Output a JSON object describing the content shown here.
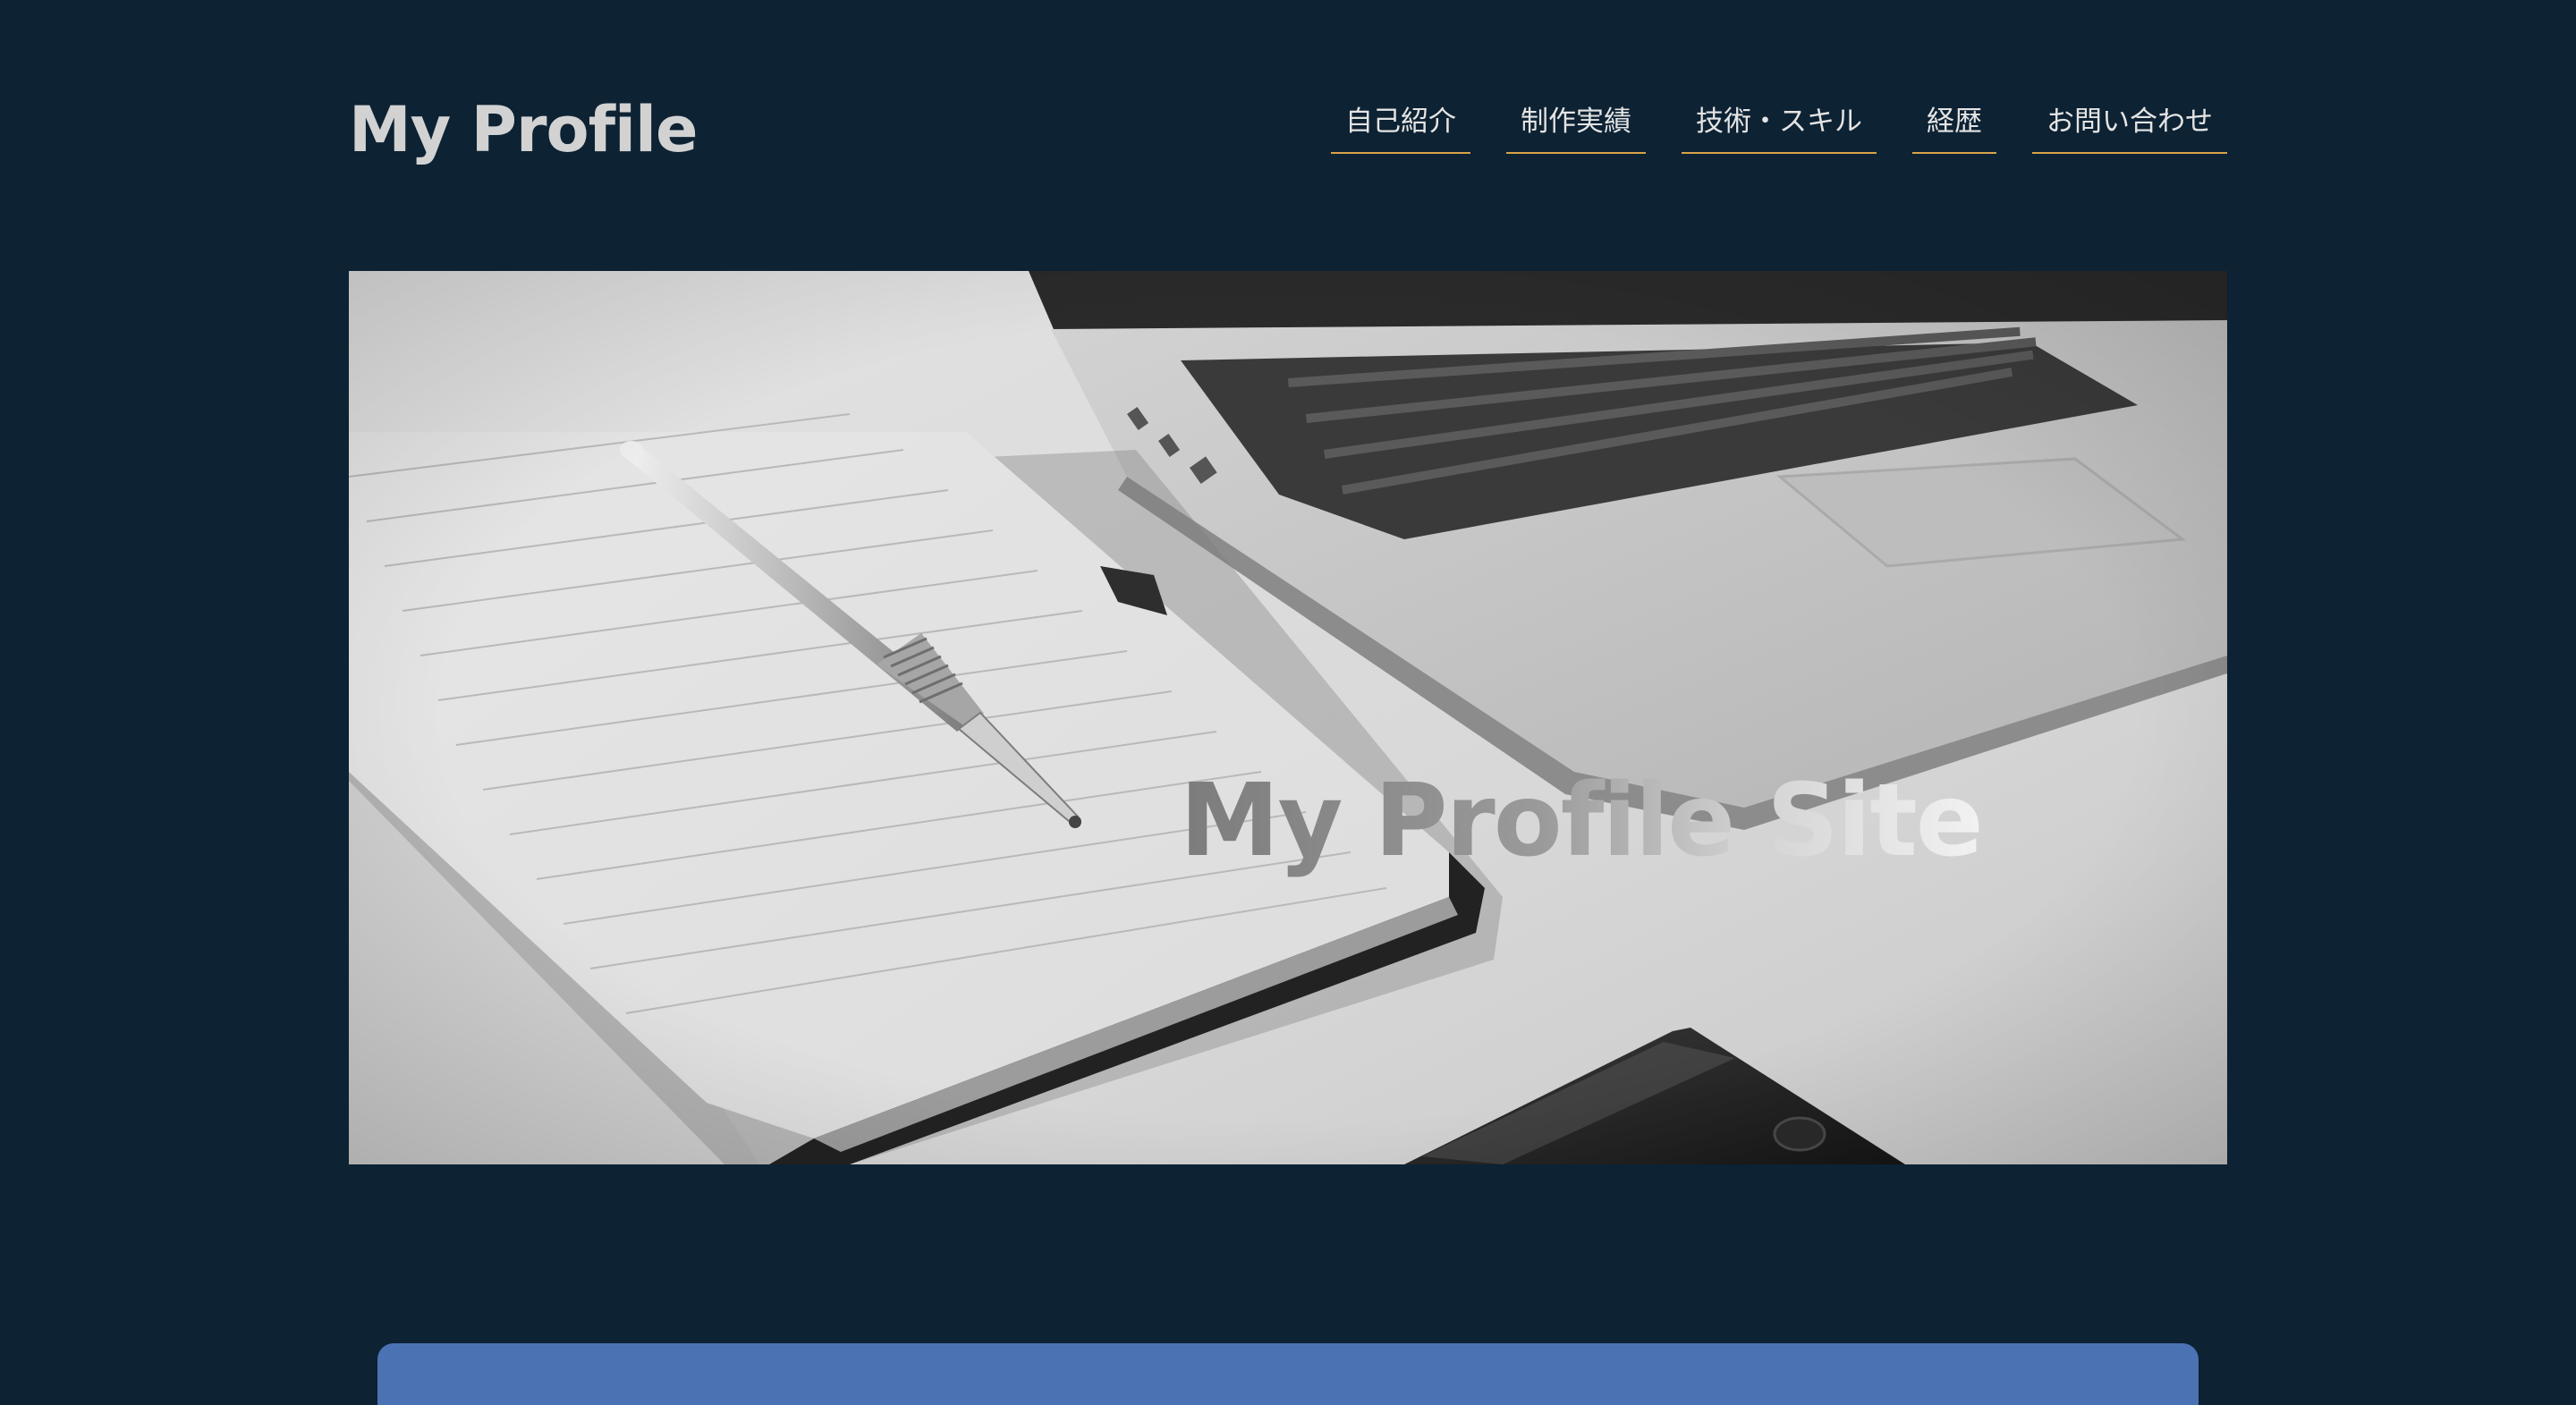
{
  "header": {
    "title": "My Profile",
    "nav": [
      {
        "label": "自己紹介"
      },
      {
        "label": "制作実績"
      },
      {
        "label": "技術・スキル"
      },
      {
        "label": "経歴"
      },
      {
        "label": "お問い合わせ"
      }
    ]
  },
  "hero": {
    "title": "My Profile Site",
    "image_subject": "notebook-pen-laptop-photo"
  },
  "colors": {
    "background": "#0d2233",
    "nav_underline": "#d9a24a",
    "card": "#4b73b3",
    "title_text": "#d2d2d2"
  }
}
